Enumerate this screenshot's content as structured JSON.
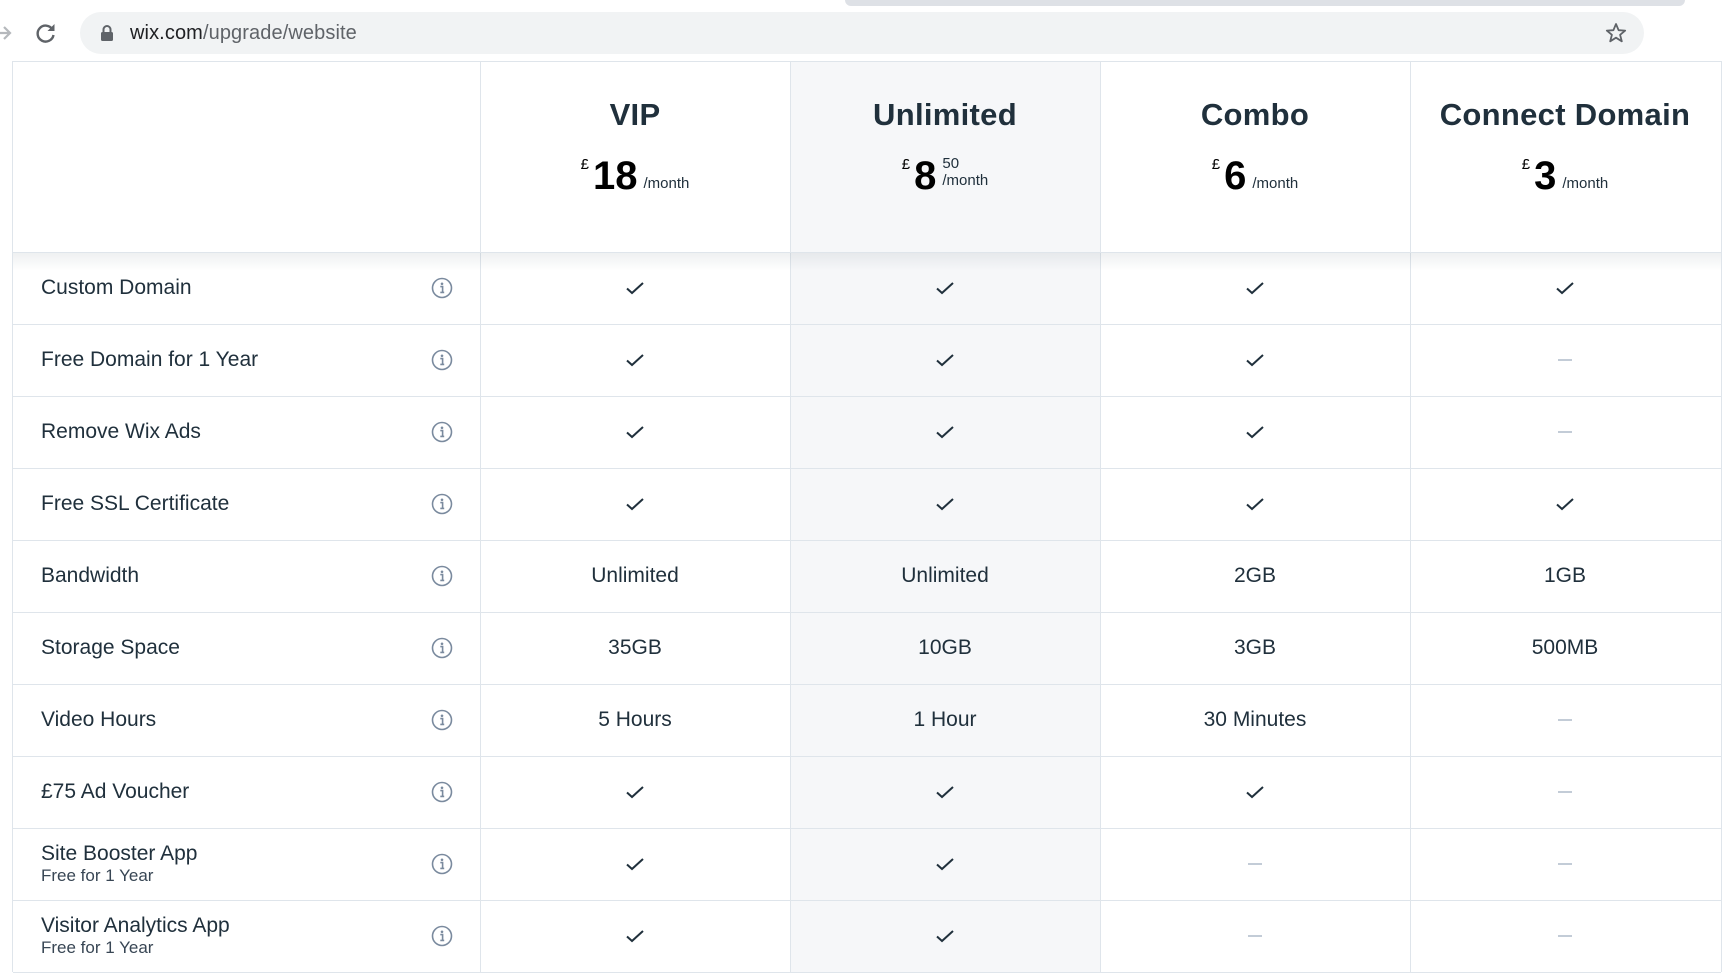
{
  "browser": {
    "url_host": "wix.com",
    "url_path": "/upgrade/website",
    "icons": [
      "forward-arrow-icon",
      "reload-icon",
      "lock-icon",
      "bookmark-star-icon"
    ]
  },
  "colors": {
    "text": "#20303c",
    "highlight_column": "#f6f7f9",
    "border": "#dfe5eb",
    "dash": "#c3ccd7",
    "info_icon": "#7a8a9e"
  },
  "plans": [
    {
      "name": "VIP",
      "currency": "£",
      "amount": "18",
      "cents": "",
      "per": "/month",
      "highlighted": false
    },
    {
      "name": "Unlimited",
      "currency": "£",
      "amount": "8",
      "cents": "50",
      "per": "/month",
      "highlighted": true
    },
    {
      "name": "Combo",
      "currency": "£",
      "amount": "6",
      "cents": "",
      "per": "/month",
      "highlighted": false
    },
    {
      "name": "Connect Domain",
      "currency": "£",
      "amount": "3",
      "cents": "",
      "per": "/month",
      "highlighted": false
    }
  ],
  "features": [
    {
      "label": "Custom Domain",
      "sub": "",
      "values": [
        "check",
        "check",
        "check",
        "check"
      ]
    },
    {
      "label": "Free Domain for 1 Year",
      "sub": "",
      "values": [
        "check",
        "check",
        "check",
        "dash"
      ]
    },
    {
      "label": "Remove Wix Ads",
      "sub": "",
      "values": [
        "check",
        "check",
        "check",
        "dash"
      ]
    },
    {
      "label": "Free SSL Certificate",
      "sub": "",
      "values": [
        "check",
        "check",
        "check",
        "check"
      ]
    },
    {
      "label": "Bandwidth",
      "sub": "",
      "values": [
        "Unlimited",
        "Unlimited",
        "2GB",
        "1GB"
      ]
    },
    {
      "label": "Storage Space",
      "sub": "",
      "values": [
        "35GB",
        "10GB",
        "3GB",
        "500MB"
      ]
    },
    {
      "label": "Video Hours",
      "sub": "",
      "values": [
        "5 Hours",
        "1 Hour",
        "30 Minutes",
        "dash"
      ]
    },
    {
      "label": "£75 Ad Voucher",
      "sub": "",
      "values": [
        "check",
        "check",
        "check",
        "dash"
      ]
    },
    {
      "label": "Site Booster App",
      "sub": "Free for 1 Year",
      "values": [
        "check",
        "check",
        "dash",
        "dash"
      ]
    },
    {
      "label": "Visitor Analytics App",
      "sub": "Free for 1 Year",
      "values": [
        "check",
        "check",
        "dash",
        "dash"
      ]
    }
  ]
}
